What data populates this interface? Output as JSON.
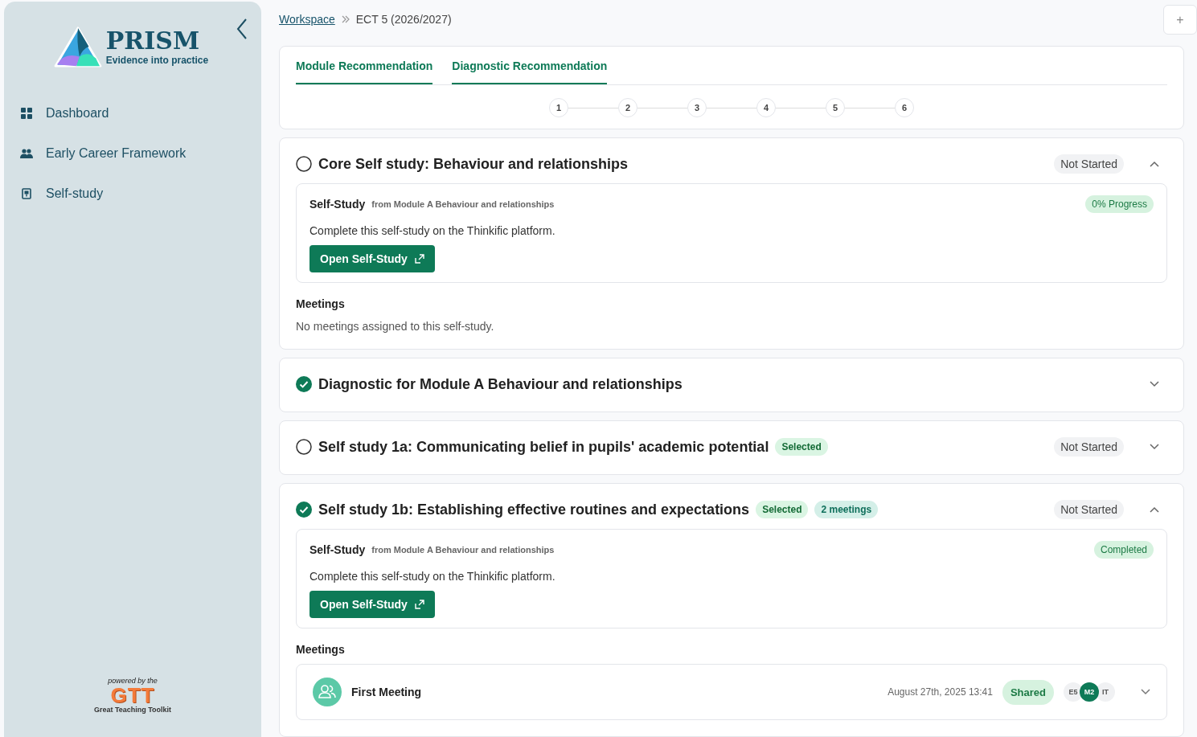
{
  "sidebar": {
    "logo": {
      "name": "PRISM",
      "tagline": "Evidence into practice"
    },
    "items": [
      {
        "label": "Dashboard",
        "kind": "grid"
      },
      {
        "label": "Early Career Framework",
        "kind": "people"
      },
      {
        "label": "Self-study",
        "kind": "board"
      }
    ],
    "footer": {
      "caption": "powered by the",
      "mark": "GTT",
      "subtitle": "Great Teaching Toolkit"
    }
  },
  "breadcrumb": {
    "link": "Workspace",
    "current": "ECT 5 (2026/2027)"
  },
  "add_button": "+",
  "tabs": [
    {
      "label": "Module Recommendation",
      "selected": true
    },
    {
      "label": "Diagnostic Recommendation",
      "selected": true
    }
  ],
  "steps": [
    "1",
    "2",
    "3",
    "4",
    "5",
    "6"
  ],
  "sections": [
    {
      "title": "Core Self study: Behaviour and relationships",
      "checked": false,
      "status": "Not Started",
      "expanded": true,
      "study": {
        "label": "Self-Study",
        "source": "from Module A Behaviour and relationships",
        "badge": "0% Progress",
        "description": "Complete this self-study on the Thinkific platform.",
        "button": "Open Self-Study"
      },
      "meetings": {
        "heading": "Meetings",
        "empty_text": "No meetings assigned to this self-study."
      }
    },
    {
      "title": "Diagnostic for Module A Behaviour and relationships",
      "checked": true,
      "expanded": false
    },
    {
      "title": "Self study 1a: Communicating belief in pupils' academic potential",
      "checked": false,
      "tags": [
        {
          "text": "Selected",
          "kind": "selected"
        }
      ],
      "status": "Not Started",
      "expanded": false
    },
    {
      "title": "Self study 1b: Establishing effective routines and expectations",
      "checked": true,
      "tags": [
        {
          "text": "Selected",
          "kind": "selected"
        },
        {
          "text": "2 meetings",
          "kind": "count"
        }
      ],
      "status": "Not Started",
      "expanded": true,
      "study": {
        "label": "Self-Study",
        "source": "from Module A Behaviour and relationships",
        "badge": "Completed",
        "description": "Complete this self-study on the Thinkific platform.",
        "button": "Open Self-Study"
      },
      "meetings": {
        "heading": "Meetings",
        "items": [
          {
            "title": "First Meeting",
            "date": "August 27th, 2025 13:41",
            "badge": "Shared",
            "participants": [
              {
                "initials": "E5",
                "highlighted": false
              },
              {
                "initials": "M2",
                "highlighted": true
              },
              {
                "initials": "IT",
                "highlighted": false
              }
            ],
            "expanded": false
          }
        ]
      }
    }
  ]
}
